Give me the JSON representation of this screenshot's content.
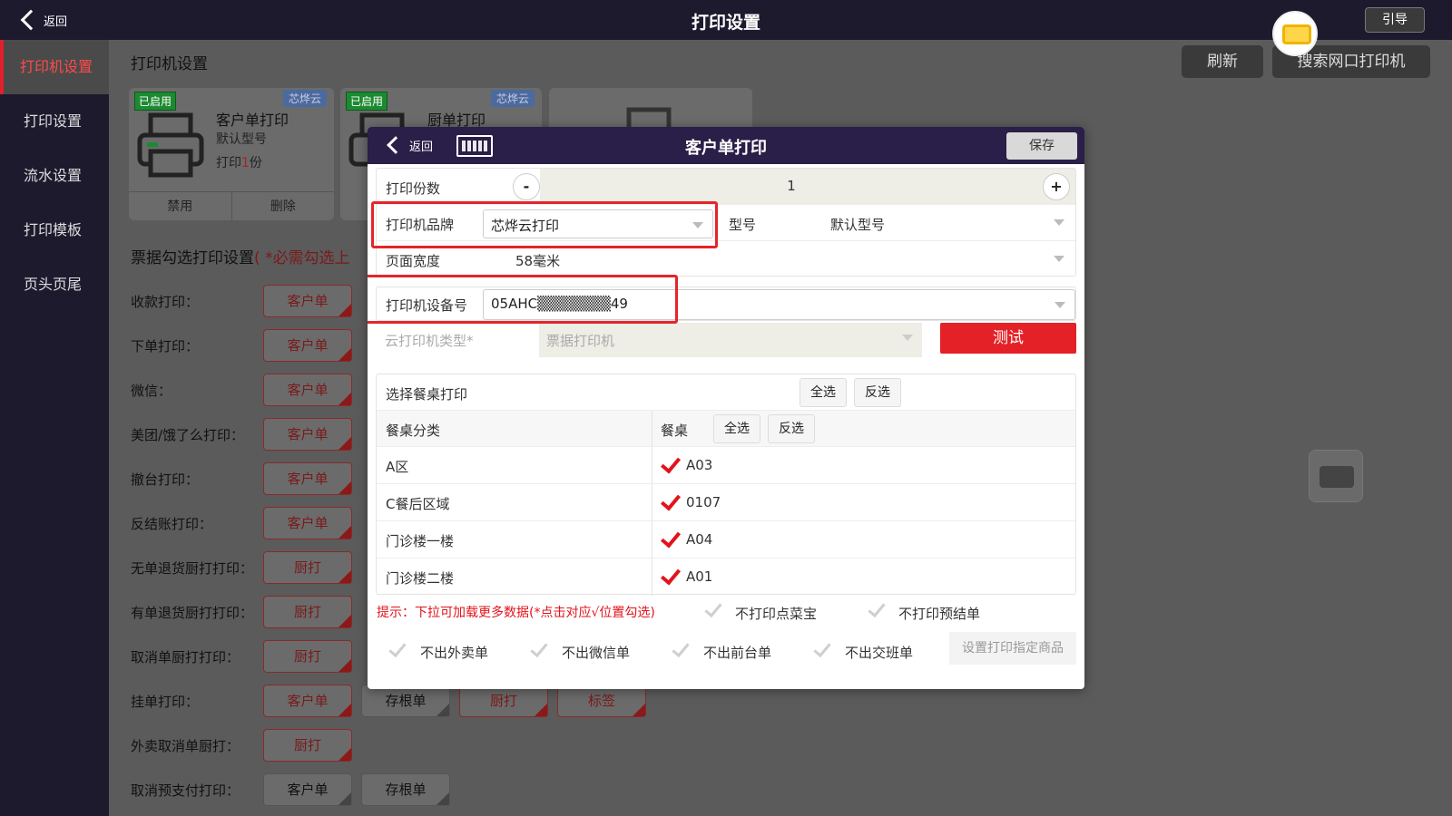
{
  "topbar": {
    "back_label": "返回",
    "title": "打印设置",
    "guide_label": "引导"
  },
  "sidebar": {
    "items": [
      {
        "label": "打印机设置",
        "active": true
      },
      {
        "label": "打印设置"
      },
      {
        "label": "流水设置"
      },
      {
        "label": "打印模板"
      },
      {
        "label": "页头页尾"
      }
    ]
  },
  "main": {
    "section_title": "打印机设置",
    "refresh_label": "刷新",
    "search_label": "搜索网口打印机",
    "cards": [
      {
        "status": "已启用",
        "cloud": "芯烨云",
        "name": "客户单打印",
        "model": "默认型号",
        "copies_prefix": "打印",
        "copies_num": "1",
        "copies_suffix": "份",
        "disable": "禁用",
        "delete": "删除"
      },
      {
        "status": "已启用",
        "cloud": "芯烨云",
        "name": "厨单打印"
      }
    ],
    "sub_title": "票据勾选打印设置",
    "sub_title_req": "( *必需勾选上",
    "options": [
      {
        "label": "收款打印：",
        "chips": [
          "客户单"
        ]
      },
      {
        "label": "下单打印：",
        "chips": [
          "客户单"
        ]
      },
      {
        "label": "微信：",
        "chips": [
          "客户单"
        ]
      },
      {
        "label": "美团/饿了么打印：",
        "chips": [
          "客户单"
        ]
      },
      {
        "label": "撤台打印：",
        "chips": [
          "客户单"
        ]
      },
      {
        "label": "反结账打印：",
        "chips": [
          "客户单"
        ]
      },
      {
        "label": "无单退货厨打打印：",
        "chips": [
          "厨打"
        ]
      },
      {
        "label": "有单退货厨打打印：",
        "chips": [
          "厨打"
        ]
      },
      {
        "label": "取消单厨打打印：",
        "chips": [
          "厨打"
        ]
      },
      {
        "label": "挂单打印：",
        "chips": [
          "客户单",
          "存根单",
          "厨打",
          "标签"
        ]
      },
      {
        "label": "外卖取消单厨打：",
        "chips": [
          "厨打"
        ]
      },
      {
        "label": "取消预支付打印：",
        "chips": [
          "客户单",
          "存根单"
        ]
      }
    ]
  },
  "modal": {
    "back_label": "返回",
    "title": "客户单打印",
    "save_label": "保存",
    "copies_label": "打印份数",
    "copies_minus": "-",
    "copies_value": "1",
    "copies_plus": "+",
    "brand_label": "打印机品牌",
    "brand_value": "芯烨云打印",
    "model_label": "型号",
    "model_value": "默认型号",
    "width_label": "页面宽度",
    "width_value": "58毫米",
    "device_label": "打印机设备号",
    "device_value": "05AHC▒▒▒▒▒▒▒49",
    "cloud_type_label": "云打印机类型*",
    "cloud_type_value": "票据打印机",
    "test_label": "测试",
    "table_select_label": "选择餐桌打印",
    "select_all": "全选",
    "invert": "反选",
    "col_category": "餐桌分类",
    "col_table": "餐桌",
    "tables": [
      {
        "category": "A区",
        "table": "A03"
      },
      {
        "category": "C餐后区域",
        "table": "0107"
      },
      {
        "category": "门诊楼一楼",
        "table": "A04"
      },
      {
        "category": "门诊楼二楼",
        "table": "A01"
      }
    ],
    "hint": "提示：下拉可加载更多数据(*点击对应√位置勾选)",
    "opt_no_dish_treasure": "不打印点菜宝",
    "opt_no_pre_bill": "不打印预结单",
    "opt_no_takeout": "不出外卖单",
    "opt_no_wechat": "不出微信单",
    "opt_no_front": "不出前台单",
    "opt_no_shift": "不出交班单",
    "set_goods_label": "设置打印指定商品"
  },
  "colors": {
    "accent_red": "#e32126",
    "header_dark": "#2a1f48",
    "sidebar_bg": "#1d1a2e"
  },
  "icons": [
    "back-chevron-icon",
    "keyboard-icon",
    "printer-icon",
    "checkmark-icon",
    "caret-down-icon"
  ]
}
